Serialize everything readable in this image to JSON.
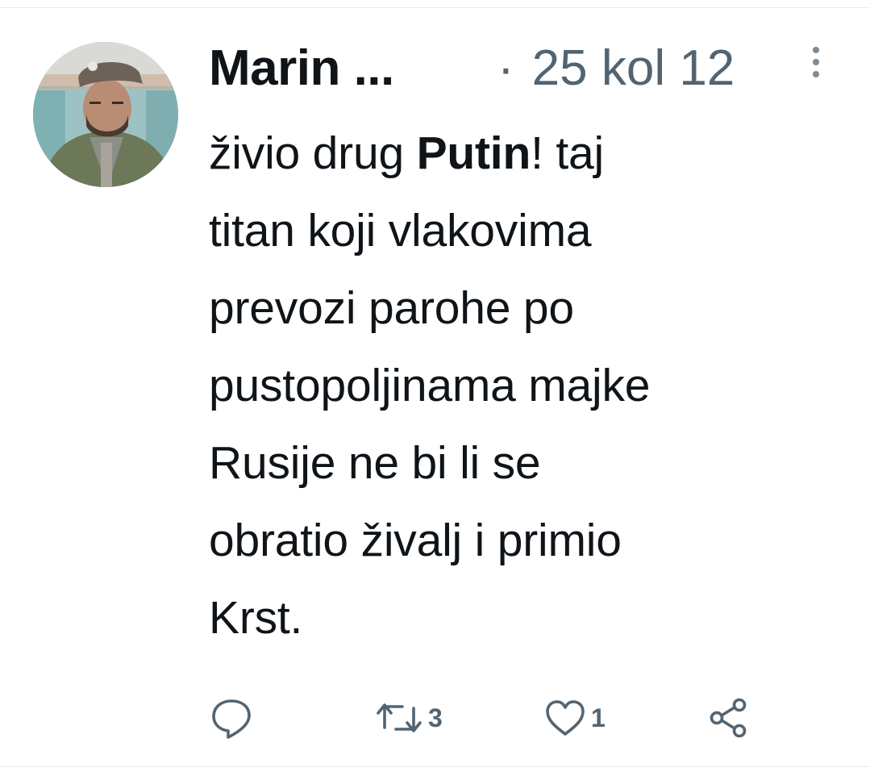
{
  "tweet": {
    "author_name": "Marin ...",
    "meta_separator": "·",
    "timestamp": "25 kol 12",
    "text_lines": [
      {
        "pre": "živio drug ",
        "bold": "Putin",
        "post": "! taj"
      },
      {
        "pre": "titan koji vlakovima",
        "bold": "",
        "post": ""
      },
      {
        "pre": "prevozi parohe po",
        "bold": "",
        "post": ""
      },
      {
        "pre": "pustopoljinama majke",
        "bold": "",
        "post": ""
      },
      {
        "pre": "Rusije ne bi li se",
        "bold": "",
        "post": ""
      },
      {
        "pre": "obratio živalj i primio",
        "bold": "",
        "post": ""
      },
      {
        "pre": "Krst.",
        "bold": "",
        "post": ""
      }
    ],
    "actions": {
      "reply_count": "",
      "retweet_count": "3",
      "like_count": "1"
    },
    "icons": {
      "avatar": "profile-photo",
      "more": "vertical-ellipsis-icon",
      "reply": "speech-bubble-icon",
      "retweet": "retweet-arrows-icon",
      "like": "heart-icon",
      "share": "share-nodes-icon"
    },
    "colors": {
      "text": "#0f1419",
      "secondary": "#536471",
      "divider": "#e6ecf0"
    }
  }
}
